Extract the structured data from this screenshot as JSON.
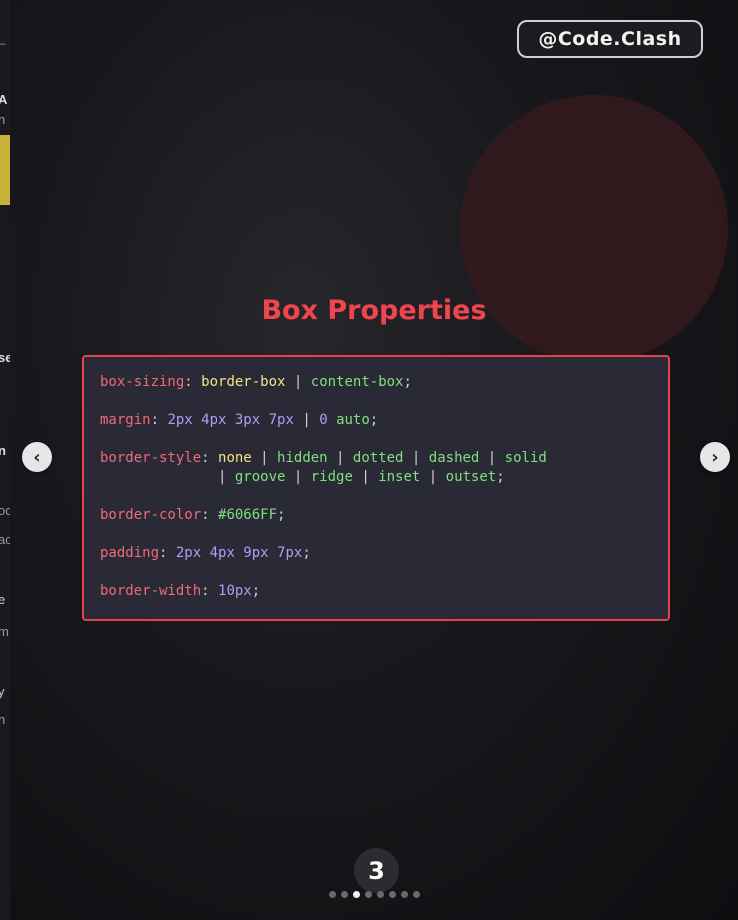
{
  "left_strip": {
    "fragments": [
      "_",
      "A",
      "n",
      "se",
      "n",
      "oc",
      "ac",
      "e",
      "m",
      "y",
      "n"
    ]
  },
  "slide": {
    "handle": "@Code.Clash",
    "title": "Box Properties",
    "code": {
      "box_sizing": {
        "prop": "box-sizing",
        "value1": "border-box",
        "sep": "|",
        "value2": "content-box"
      },
      "margin": {
        "prop": "margin",
        "values": "2px 4px 3px 7px",
        "sep": "|",
        "alt_num": "0",
        "alt_kw": "auto"
      },
      "border_style": {
        "prop": "border-style",
        "line1": [
          "none",
          "hidden",
          "dotted",
          "dashed",
          "solid"
        ],
        "line2": [
          "groove",
          "ridge",
          "inset",
          "outset"
        ]
      },
      "border_color": {
        "prop": "border-color",
        "value": "#6066FF"
      },
      "padding": {
        "prop": "padding",
        "values": "2px 4px 9px 7px"
      },
      "border_width": {
        "prop": "border-width",
        "value": "10px"
      }
    },
    "page_number": "3",
    "pagination": {
      "total": 8,
      "active_index": 2
    }
  },
  "colors": {
    "accent": "#f0454f",
    "property": "#f06a78",
    "keyword": "#f3e487",
    "string": "#7ee07d",
    "number": "#b59af2"
  },
  "nav": {
    "prev_icon": "chevron-left-icon",
    "next_icon": "chevron-right-icon"
  }
}
